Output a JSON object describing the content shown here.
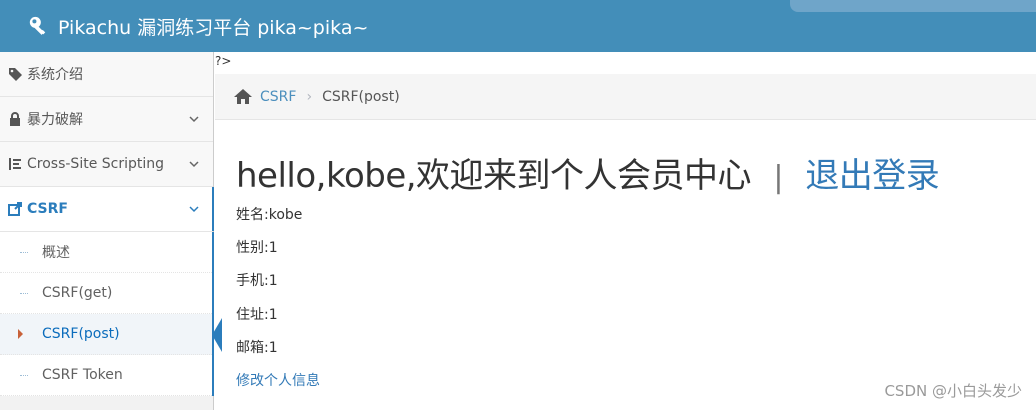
{
  "header": {
    "title": "Pikachu 漏洞练习平台 pika~pika~"
  },
  "sidebar": {
    "items": [
      {
        "label": "系统介绍",
        "icon": "tags-icon"
      },
      {
        "label": "暴力破解",
        "icon": "lock-icon"
      },
      {
        "label": "Cross-Site Scripting",
        "icon": "list-icon"
      },
      {
        "label": "CSRF",
        "icon": "share-icon"
      }
    ],
    "csrf_submenu": [
      "概述",
      "CSRF(get)",
      "CSRF(post)",
      "CSRF Token"
    ],
    "active_subitem": "CSRF(post)"
  },
  "main": {
    "stray_text": "?>",
    "breadcrumb": {
      "parent": "CSRF",
      "separator": "›",
      "current": "CSRF(post)"
    },
    "headline": {
      "greeting": "hello,kobe,欢迎来到个人会员中心",
      "divider": "|",
      "logout": "退出登录"
    },
    "profile": {
      "name": "姓名:kobe",
      "gender": "性别:1",
      "phone": "手机:1",
      "address": "住址:1",
      "email": "邮箱:1"
    },
    "edit_link": "修改个人信息"
  },
  "watermark": "CSDN @小白头发少",
  "colors": {
    "navbar": "#438eb9",
    "accent": "#2b7dbc",
    "link": "#337ab7"
  }
}
